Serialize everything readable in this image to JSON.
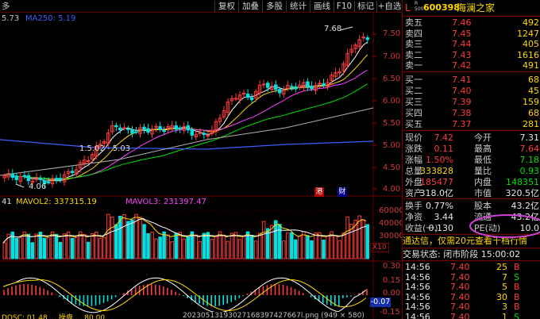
{
  "toolbar": {
    "left_text": "多",
    "buttons": [
      "复权",
      "加叠",
      "多股",
      "统计",
      "画线",
      "F10",
      "标记",
      "+自选",
      "返回"
    ]
  },
  "chart": {
    "ma_label_a": "5.73",
    "ma_label_b": "MA250: 5.19",
    "high_marker": "7.68",
    "low_marker": "4.06",
    "mid_marker": "1.5.02 - 5.03",
    "y_ticks": [
      "7.50",
      "7.00",
      "6.50",
      "6.00",
      "5.50",
      "5.00",
      "4.50",
      "4.00"
    ],
    "tag_port": "港",
    "tag_finance": "财",
    "volume_header": {
      "v1": "41",
      "v2": "MAVOL2: 337315.19",
      "v3": "MAVOL3: 231397.47"
    },
    "vol_ticks": [
      "60000",
      "40000",
      "30000"
    ],
    "vol_unit": "X10",
    "macd_ticks": [
      "0.30",
      "0.15",
      "0.00",
      "-0.15"
    ],
    "macd_value": "-0.07",
    "bottom_header": "DOSC: 01.48  ...  操盘 ... 80.00",
    "filename": "20230513193027168397427667l.png (949 × 580)"
  },
  "quote": {
    "flag": "L",
    "sub_flag": "R\n500",
    "code": "600398",
    "name": "海澜之家",
    "asks": [
      {
        "label": "卖五",
        "price": "7.46",
        "vol": "492"
      },
      {
        "label": "卖四",
        "price": "7.45",
        "vol": "1247"
      },
      {
        "label": "卖三",
        "price": "7.44",
        "vol": "405"
      },
      {
        "label": "卖二",
        "price": "7.43",
        "vol": "1616"
      },
      {
        "label": "卖一",
        "price": "7.42",
        "vol": "491"
      }
    ],
    "bids": [
      {
        "label": "买一",
        "price": "7.41",
        "vol": "68"
      },
      {
        "label": "买二",
        "price": "7.40",
        "vol": "45"
      },
      {
        "label": "买三",
        "price": "7.39",
        "vol": "159"
      },
      {
        "label": "买四",
        "price": "7.38",
        "vol": "68"
      },
      {
        "label": "买五",
        "price": "7.37",
        "vol": "281"
      }
    ],
    "stats": [
      {
        "l1": "现价",
        "v1": "7.42",
        "c1": "red",
        "l2": "今开",
        "v2": "7.31",
        "c2": "white"
      },
      {
        "l1": "涨跌",
        "v1": "0.11",
        "c1": "red",
        "l2": "最高",
        "v2": "7.64",
        "c2": "red"
      },
      {
        "l1": "涨幅",
        "v1": "1.50%",
        "c1": "red",
        "l2": "最低",
        "v2": "7.18",
        "c2": "green"
      },
      {
        "l1": "总量",
        "v1": "333828",
        "c1": "yellow",
        "l2": "量比",
        "v2": "0.93",
        "c2": "green"
      },
      {
        "l1": "外盘",
        "v1": "185477",
        "c1": "red",
        "l2": "内盘",
        "v2": "148351",
        "c2": "green"
      },
      {
        "l1": "资产",
        "v1": "318.0亿",
        "c1": "white",
        "l2": "市值",
        "v2": "320.5亿",
        "c2": "white"
      }
    ],
    "stats2": [
      {
        "l1": "换手",
        "v1": "0.77%",
        "c1": "white",
        "l2": "股本",
        "v2": "43.2亿",
        "c2": "white"
      },
      {
        "l1": "净资",
        "v1": "3.44",
        "c1": "white",
        "l2": "流通",
        "v2": "43.2亿",
        "c2": "white"
      },
      {
        "l1": "收益(一)",
        "v1": "0.130",
        "c1": "white",
        "l2": "PE(动)",
        "v2": "10.0",
        "c2": "white"
      }
    ],
    "ad_text": "通达信，仅需20元查看千档行情",
    "status_text": "交易状态: 闭市阶段 15:00:02",
    "ticks": [
      {
        "time": "14:56",
        "price": "7.40",
        "vol": "25",
        "side": "B"
      },
      {
        "time": "14:56",
        "price": "7.40",
        "vol": "7",
        "side": "S"
      },
      {
        "time": "14:56",
        "price": "7.40",
        "vol": "5",
        "side": "B"
      },
      {
        "time": "14:56",
        "price": "7.40",
        "vol": "30",
        "side": "B"
      },
      {
        "time": "14:56",
        "price": "7.40",
        "vol": "3",
        "side": "B"
      },
      {
        "time": "14:56",
        "price": "7.40",
        "vol": "1",
        "side": "S"
      }
    ]
  },
  "colors": {
    "up": "#ff3b3b",
    "down": "#00e0e0",
    "ma5": "#ffffff",
    "ma10": "#ffd800",
    "ma20": "#ff44ff",
    "ma60": "#00e000",
    "ma250": "#3a5fff",
    "grid": "#6a0000",
    "circle": "#d040d0"
  }
}
